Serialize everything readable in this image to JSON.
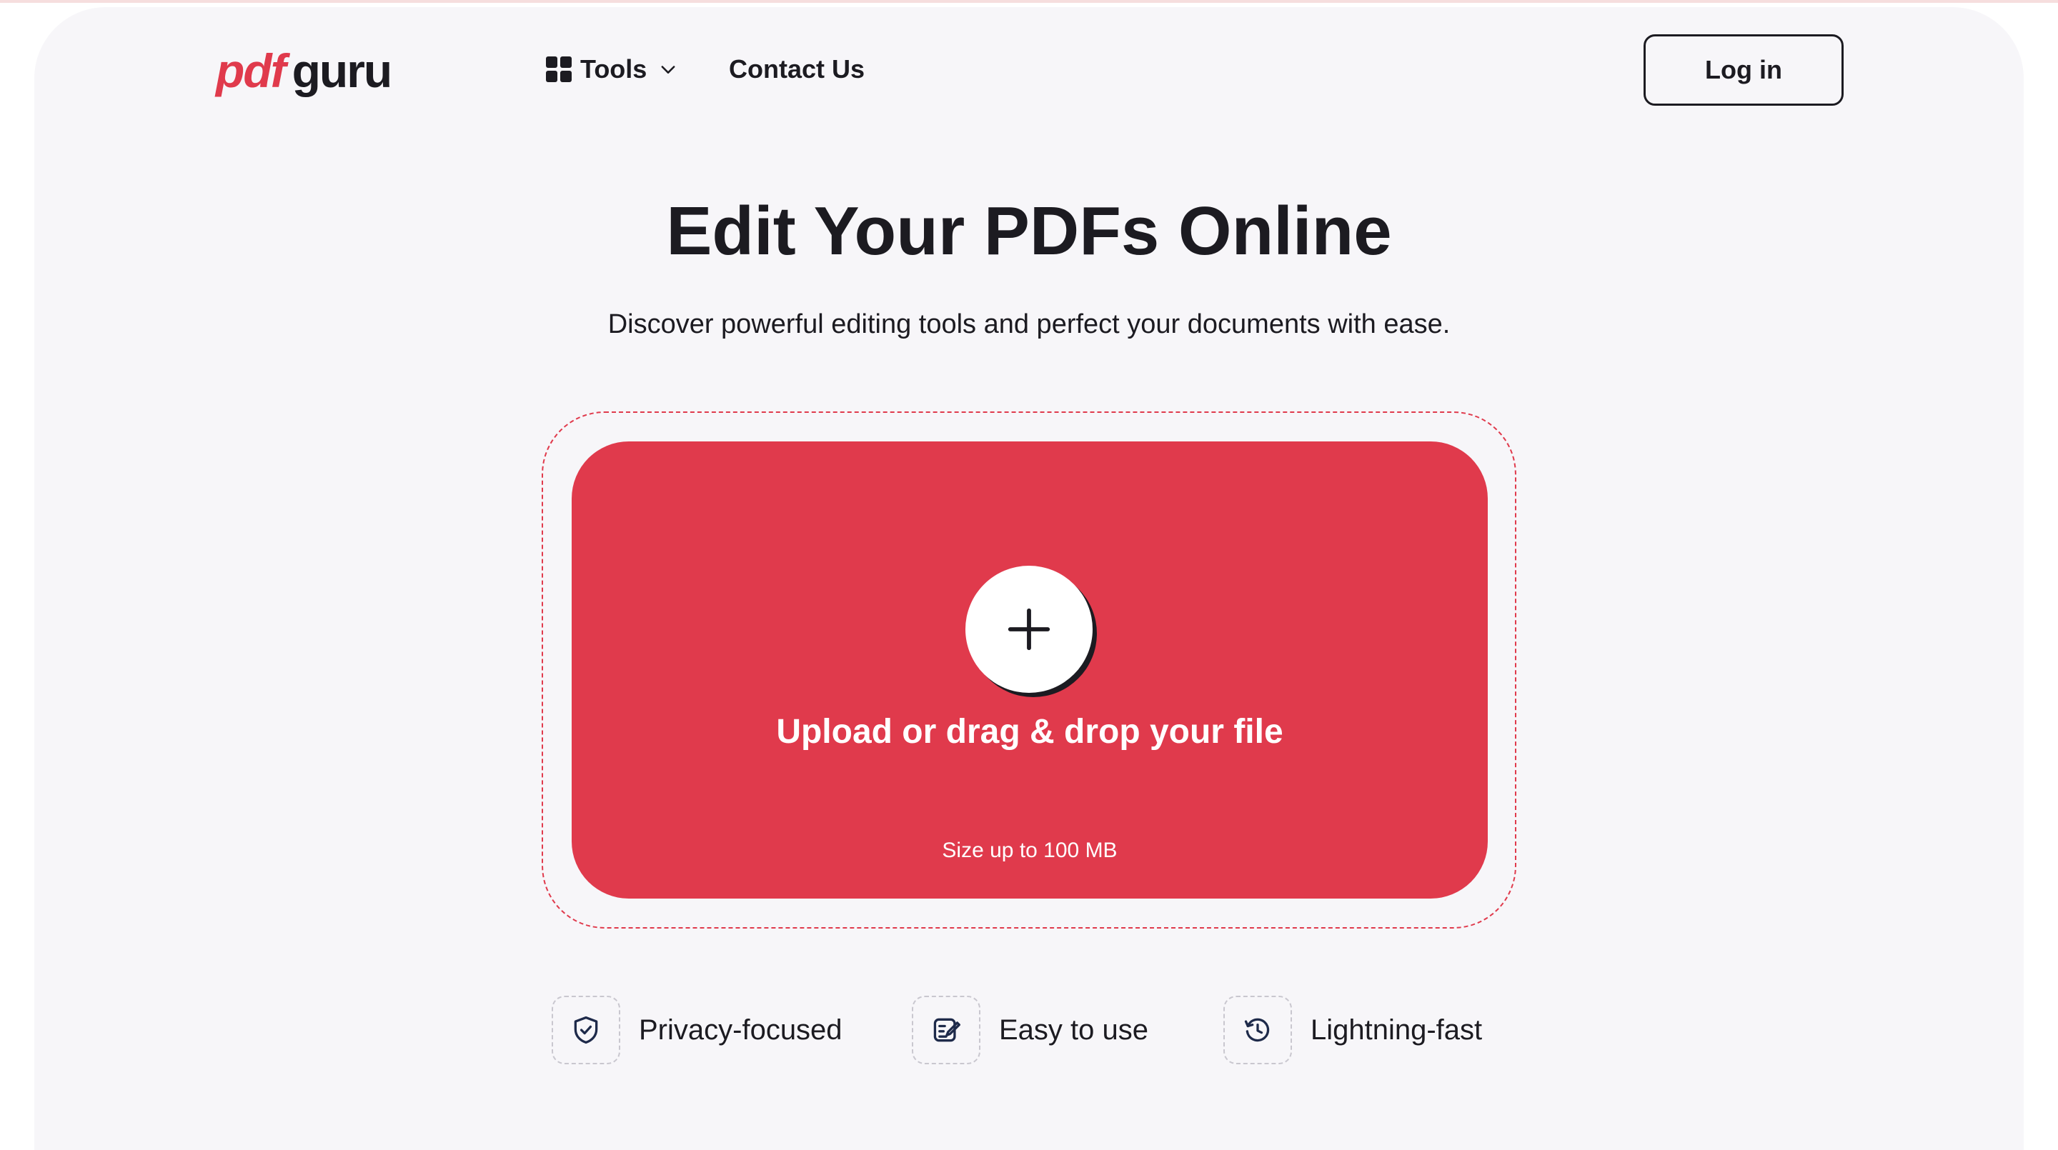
{
  "header": {
    "logo": {
      "part1": "pdf",
      "part2": "guru"
    },
    "nav": {
      "tools_label": "Tools",
      "contact_label": "Contact Us"
    },
    "login_label": "Log in"
  },
  "hero": {
    "title": "Edit Your PDFs Online",
    "subtitle": "Discover powerful editing tools and perfect your documents with ease."
  },
  "upload": {
    "label": "Upload or drag & drop your file",
    "size_note": "Size up to 100 MB",
    "icon": "plus-icon"
  },
  "features": [
    {
      "icon": "shield-check-icon",
      "label": "Privacy-focused"
    },
    {
      "icon": "edit-note-icon",
      "label": "Easy to use"
    },
    {
      "icon": "clock-history-icon",
      "label": "Lightning-fast"
    }
  ],
  "colors": {
    "brand_red": "#e03a4c",
    "text_dark": "#1c1b21",
    "page_bg": "#f7f6f9",
    "icon_navy": "#1e2a4a"
  }
}
